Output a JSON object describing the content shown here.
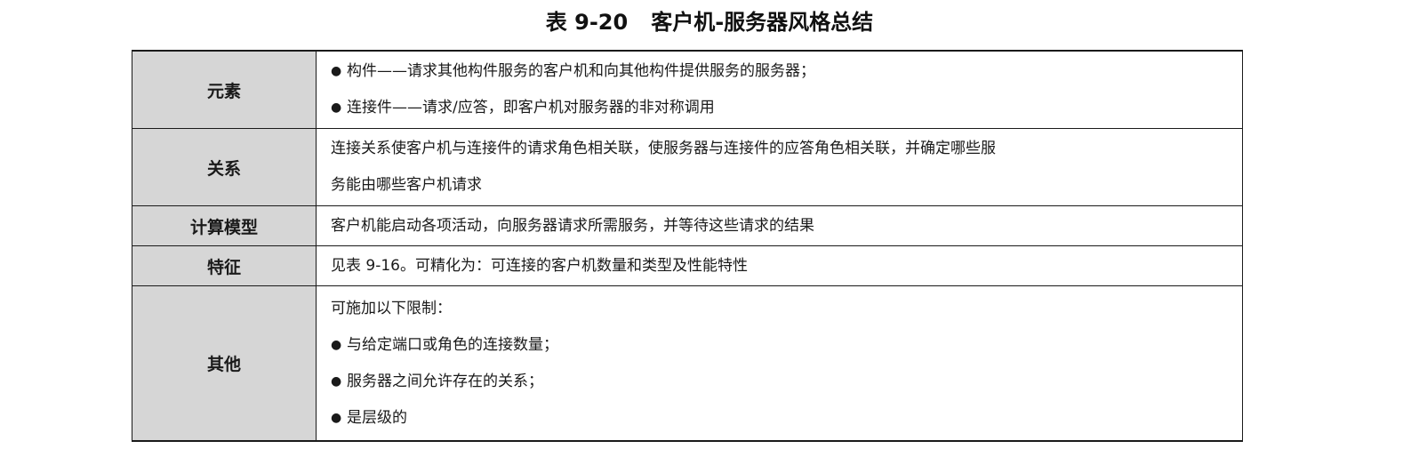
{
  "caption": {
    "number": "表 9-20",
    "title": "客户机-服务器风格总结"
  },
  "rows": [
    {
      "label": "元素",
      "bullets": [
        "构件——请求其他构件服务的客户机和向其他构件提供服务的服务器；",
        "连接件——请求/应答，即客户机对服务器的非对称调用"
      ]
    },
    {
      "label": "关系",
      "text_lines": [
        "连接关系使客户机与连接件的请求角色相关联，使服务器与连接件的应答角色相关联，并确定哪些服",
        "务能由哪些客户机请求"
      ]
    },
    {
      "label": "计算模型",
      "text": "客户机能启动各项活动，向服务器请求所需服务，并等待这些请求的结果"
    },
    {
      "label": "特征",
      "text": "见表 9-16。可精化为：可连接的客户机数量和类型及性能特性"
    },
    {
      "label": "其他",
      "intro": "可施加以下限制：",
      "bullets": [
        "与给定端口或角色的连接数量；",
        "服务器之间允许存在的关系；",
        "是层级的"
      ]
    }
  ]
}
